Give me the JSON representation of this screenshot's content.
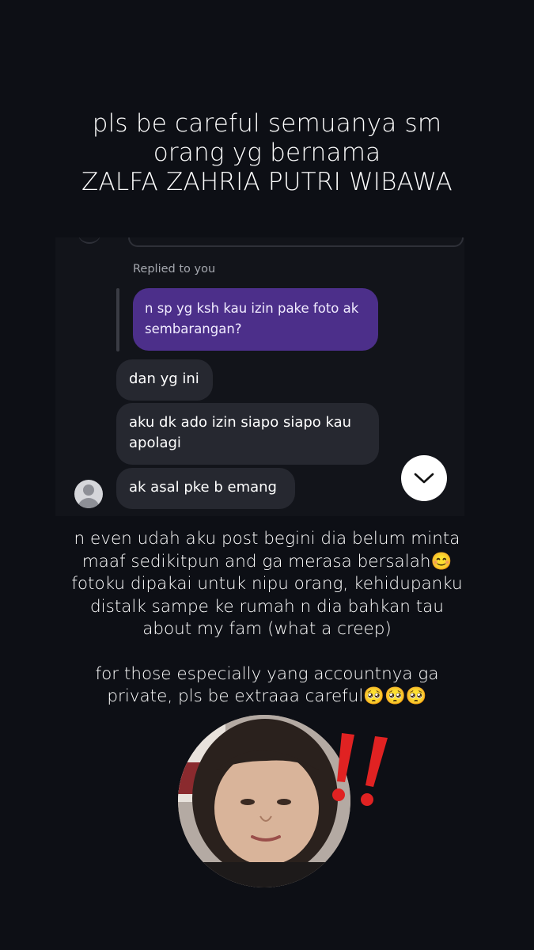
{
  "headline": {
    "line1": "pls be careful semuanya sm",
    "line2": "orang yg bernama",
    "line3": "ZALFA ZAHRIA PUTRI WIBAWA"
  },
  "chat": {
    "replied_label": "Replied to you",
    "replied_message": "n sp yg ksh kau izin pake foto ak sembarangan?",
    "messages": [
      "dan yg ini",
      "aku dk ado izin siapo siapo kau apolagi",
      "ak asal pke b emang"
    ],
    "scroll_icon": "chevron-down-icon",
    "avatar_icon": "default-user-avatar",
    "colors": {
      "purple_bubble": "#4c2f8a",
      "gray_bubble": "#262830",
      "background": "#0d0f15"
    }
  },
  "caption": {
    "lines": [
      "n even udah aku post begini dia belum minta",
      "maaf sedikitpun and ga merasa bersalah😊",
      "fotoku dipakai untuk nipu orang, kehidupanku",
      "distalk sampe ke rumah n dia bahkan tau",
      "about my fam (what a creep)"
    ],
    "lines2": [
      "for those especially yang accountnya ga",
      "private, pls be extraaa careful🥺🥺🥺"
    ]
  },
  "photo": {
    "description_icon": "person-photo",
    "exclamation_icon": "double-exclamation-icon"
  }
}
